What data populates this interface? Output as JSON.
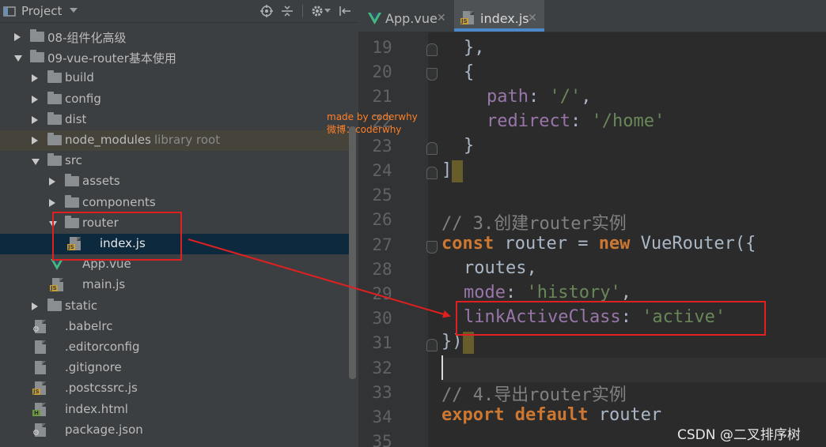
{
  "project": {
    "title": "Project",
    "tree": [
      {
        "label": "08-组件化高级",
        "type": "folder",
        "state": "collapsed",
        "depth": 0
      },
      {
        "label": "09-vue-router基本使用",
        "type": "folder",
        "state": "expanded",
        "depth": 0
      },
      {
        "label": "build",
        "type": "folder",
        "state": "collapsed",
        "depth": 1
      },
      {
        "label": "config",
        "type": "folder",
        "state": "collapsed",
        "depth": 1
      },
      {
        "label": "dist",
        "type": "folder",
        "state": "collapsed",
        "depth": 1
      },
      {
        "label": "node_modules",
        "sublabel": "library root",
        "type": "folder",
        "state": "collapsed",
        "depth": 1
      },
      {
        "label": "src",
        "type": "folder",
        "state": "expanded",
        "depth": 1
      },
      {
        "label": "assets",
        "type": "folder",
        "state": "collapsed",
        "depth": 2
      },
      {
        "label": "components",
        "type": "folder",
        "state": "collapsed",
        "depth": 2
      },
      {
        "label": "router",
        "type": "folder",
        "state": "expanded",
        "depth": 2
      },
      {
        "label": "index.js",
        "type": "js",
        "depth": 3
      },
      {
        "label": "App.vue",
        "type": "vue",
        "depth": 2
      },
      {
        "label": "main.js",
        "type": "js",
        "depth": 2
      },
      {
        "label": "static",
        "type": "folder",
        "state": "collapsed",
        "depth": 1
      },
      {
        "label": ".babelrc",
        "type": "config",
        "depth": 1
      },
      {
        "label": ".editorconfig",
        "type": "text",
        "depth": 1
      },
      {
        "label": ".gitignore",
        "type": "text",
        "depth": 1
      },
      {
        "label": ".postcssrc.js",
        "type": "js",
        "depth": 1
      },
      {
        "label": "index.html",
        "type": "html",
        "depth": 1
      },
      {
        "label": "package.json",
        "type": "config",
        "depth": 1
      }
    ]
  },
  "tabs": [
    {
      "label": "App.vue",
      "icon": "vue-icon",
      "active": false
    },
    {
      "label": "index.js",
      "icon": "js-file-icon",
      "active": true
    }
  ],
  "editor": {
    "line_numbers": [
      "19",
      "20",
      "21",
      "22",
      "23",
      "24",
      "25",
      "26",
      "27",
      "28",
      "29",
      "30",
      "31",
      "32",
      "33",
      "34",
      "35"
    ],
    "line19": "},",
    "line20": "{",
    "line21_key": "path",
    "line21_val": "'/'",
    "line22_key": "redirect",
    "line22_val": "'/home'",
    "line23": "}",
    "line24": "]",
    "line26": "// 3.创建router实例",
    "line27_kw1": "const",
    "line27_mid": " router = ",
    "line27_kw2": "new",
    "line27_end": " VueRouter({",
    "line28": "routes,",
    "line29_key": "mode",
    "line29_val": "'history'",
    "line30_key": "linkActiveClass",
    "line30_val": "'active'",
    "line31": "})",
    "line33": "// 4.导出router实例",
    "line34_kw1": "export",
    "line34_kw2": "default",
    "line34_end": " router"
  },
  "watermark": {
    "line1": "made by coderwhy",
    "line2": "微博：coderwhy"
  },
  "csdn_mark": "CSDN @二叉排序树",
  "colors": {
    "panel_bg": "#3c3f41",
    "editor_bg": "#2b2b2b",
    "keyword": "#cc7832",
    "property": "#9876aa",
    "string": "#6a8759",
    "comment": "#808080",
    "annotation_red": "#e02020",
    "watermark_orange": "#ff7f27"
  }
}
